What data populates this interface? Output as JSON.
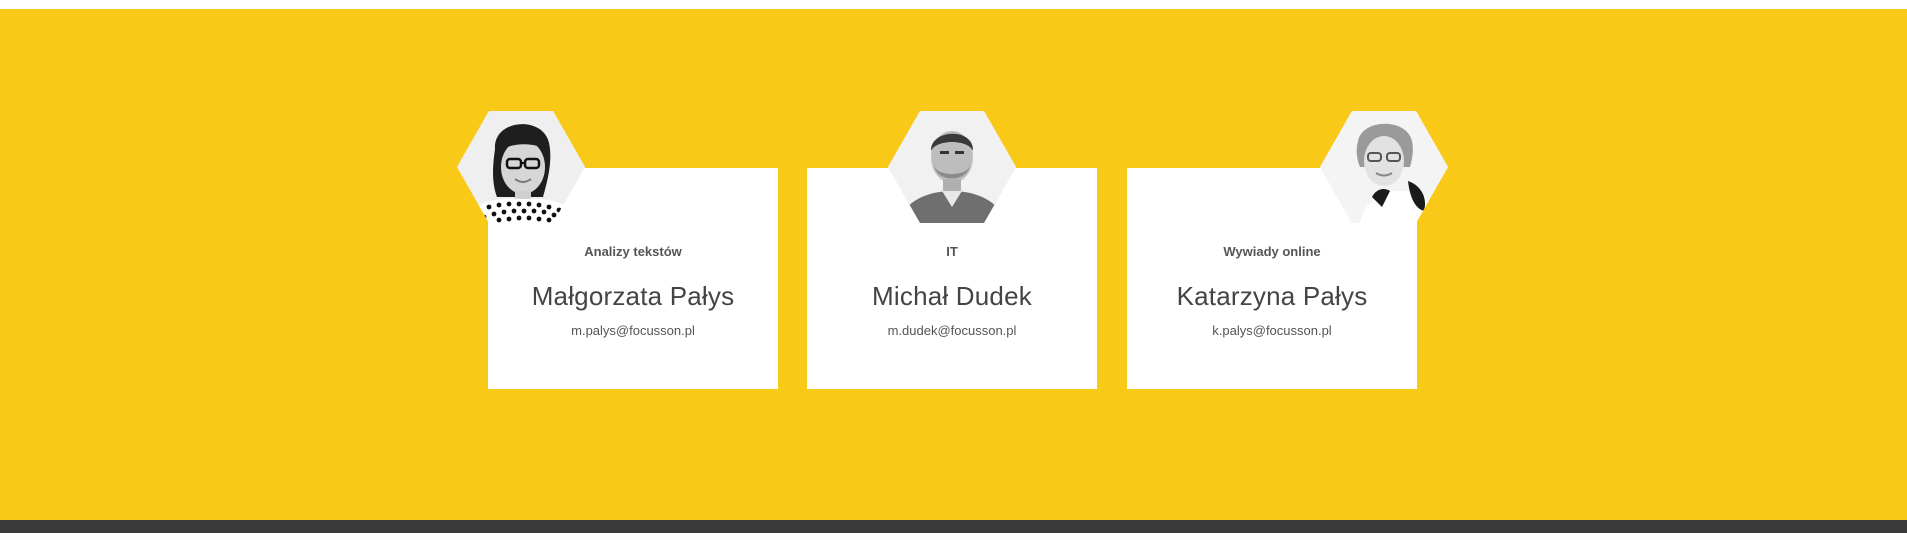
{
  "team": [
    {
      "category": "Analizy tekstów",
      "name": "Małgorzata Pałys",
      "email": "m.palys@focusson.pl"
    },
    {
      "category": "IT",
      "name": "Michał Dudek",
      "email": "m.dudek@focusson.pl"
    },
    {
      "category": "Wywiady online",
      "name": "Katarzyna Pałys",
      "email": "k.palys@focusson.pl"
    }
  ],
  "colors": {
    "band": "#f9c918",
    "card": "#ffffff",
    "footer": "#3a3a3a",
    "text": "#444444"
  }
}
